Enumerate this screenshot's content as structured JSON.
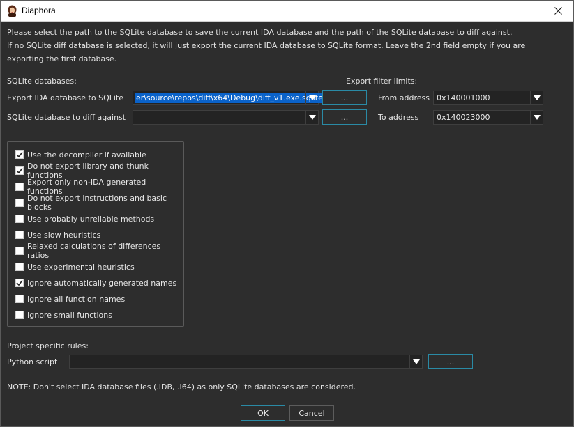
{
  "window": {
    "title": "Diaphora"
  },
  "description": [
    "Please select the path to the SQLite database to save the current IDA database and the path of the SQLite database to diff against.",
    "If no SQLite diff database is selected, it will just export the current IDA database to SQLite format. Leave the 2nd field empty if you are",
    "exporting the first database."
  ],
  "sqlite": {
    "heading": "SQLite databases:",
    "export_label": "Export IDA database to SQLite",
    "export_value": "er\\source\\repos\\diff\\x64\\Debug\\diff_v1.exe.sqlite",
    "diff_label": "SQLite database to diff against",
    "diff_value": "",
    "browse_label": "..."
  },
  "filter": {
    "heading": "Export filter limits:",
    "from_label": "From address",
    "from_value": "0x140001000",
    "to_label": "To address",
    "to_value": "0x140023000"
  },
  "options": [
    {
      "label": "Use the decompiler if available",
      "checked": true
    },
    {
      "label": "Do not export library and thunk functions",
      "checked": true
    },
    {
      "label": "Export only non-IDA generated functions",
      "checked": false
    },
    {
      "label": "Do not export instructions and basic blocks",
      "checked": false
    },
    {
      "label": "Use probably unreliable methods",
      "checked": false
    },
    {
      "label": "Use slow heuristics",
      "checked": false
    },
    {
      "label": "Relaxed calculations of differences ratios",
      "checked": false
    },
    {
      "label": "Use experimental heuristics",
      "checked": false
    },
    {
      "label": "Ignore automatically generated names",
      "checked": true
    },
    {
      "label": "Ignore all function names",
      "checked": false
    },
    {
      "label": "Ignore small functions",
      "checked": false
    }
  ],
  "project": {
    "heading": "Project specific rules:",
    "python_label": "Python script",
    "python_value": "",
    "browse_label": "..."
  },
  "note": "NOTE: Don't select IDA database files (.IDB, .I64) as only SQLite databases are considered.",
  "buttons": {
    "ok": "OK",
    "cancel": "Cancel"
  },
  "colors": {
    "background": "#2d2d2d",
    "accent_border": "#2a8aa5",
    "selection": "#0a62c9"
  }
}
